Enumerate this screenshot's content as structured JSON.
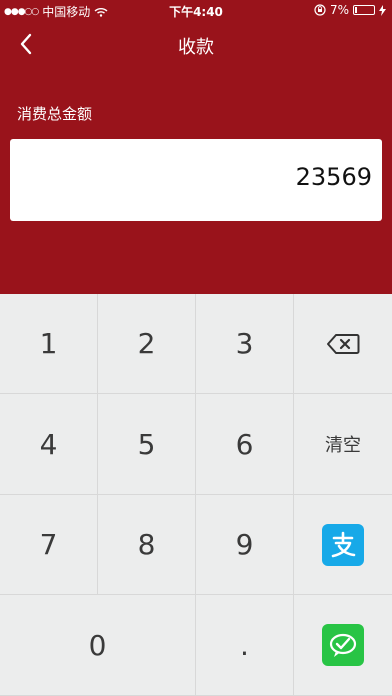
{
  "status_bar": {
    "signal": "●●●○○",
    "carrier": "中国移动",
    "time": "下午4:40",
    "battery": "7%"
  },
  "nav": {
    "title": "收款"
  },
  "amount": {
    "label": "消费总金额",
    "value": "23569"
  },
  "keypad": {
    "keys": [
      "1",
      "2",
      "3",
      "4",
      "5",
      "6",
      "7",
      "8",
      "9",
      "0",
      "."
    ],
    "clear_label": "清空"
  },
  "colors": {
    "header_bg": "#99131b",
    "alipay": "#17a9e8",
    "wechat": "#28c445"
  },
  "icons": {
    "back": "chevron-left-icon",
    "backspace": "backspace-icon",
    "alipay": "alipay-icon",
    "wechat_pay": "wechat-pay-icon"
  }
}
